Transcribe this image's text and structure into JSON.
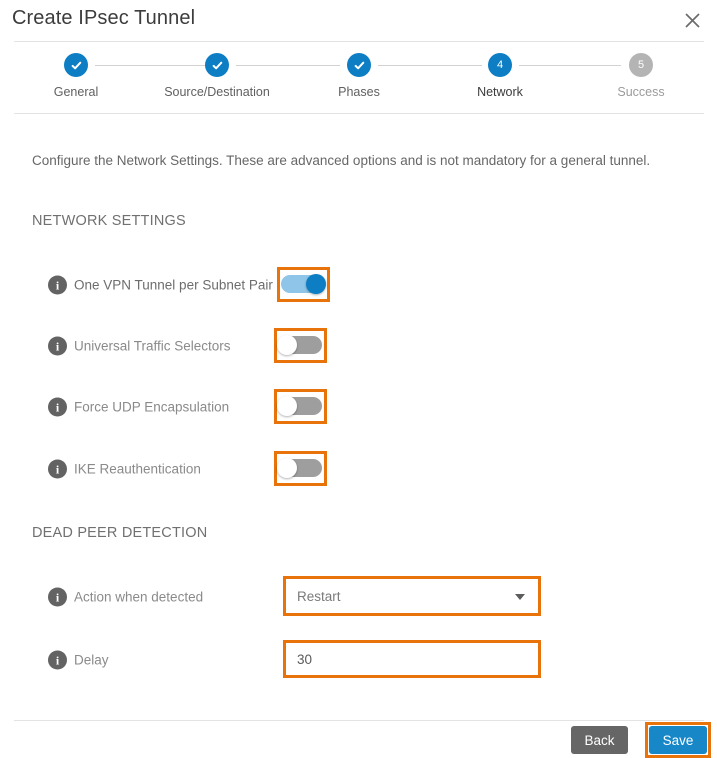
{
  "window": {
    "title": "Create IPsec Tunnel",
    "close_icon": "close-icon"
  },
  "colors": {
    "accent_blue": "#0d7dc4",
    "highlight_orange": "#e8730a",
    "toggle_on_track": "#8ec5e8",
    "toggle_off_track": "#9e9e9e",
    "inactive_gray": "#b4b4b4",
    "save_button": "#1787c8",
    "back_button": "#666666"
  },
  "stepper": {
    "steps": [
      {
        "label": "General",
        "indicator": "check",
        "state": "done"
      },
      {
        "label": "Source/Destination",
        "indicator": "check",
        "state": "done"
      },
      {
        "label": "Phases",
        "indicator": "check",
        "state": "done"
      },
      {
        "label": "Network",
        "indicator": "4",
        "state": "active"
      },
      {
        "label": "Success",
        "indicator": "5",
        "state": "todo"
      }
    ]
  },
  "body": {
    "intro": "Configure the Network Settings. These are advanced options and is not mandatory for a general tunnel.",
    "sections": [
      {
        "title": "NETWORK SETTINGS"
      },
      {
        "title": "DEAD PEER DETECTION"
      }
    ],
    "network_settings": [
      {
        "label": "One VPN Tunnel per Subnet Pair",
        "info_icon": "info-icon",
        "toggle": "on",
        "highlighted": true
      },
      {
        "label": "Universal Traffic Selectors",
        "info_icon": "info-icon",
        "toggle": "off",
        "highlighted": true
      },
      {
        "label": "Force UDP Encapsulation",
        "info_icon": "info-icon",
        "toggle": "off",
        "highlighted": true
      },
      {
        "label": "IKE Reauthentication",
        "info_icon": "info-icon",
        "toggle": "off",
        "highlighted": true
      }
    ],
    "dead_peer_detection": {
      "action": {
        "label": "Action when detected",
        "info_icon": "info-icon",
        "value": "Restart",
        "caret_icon": "chevron-down-icon",
        "highlighted": true
      },
      "delay": {
        "label": "Delay",
        "info_icon": "info-icon",
        "value": "30",
        "placeholder": "",
        "highlighted": true
      }
    }
  },
  "footer": {
    "back_label": "Back",
    "save_label": "Save",
    "save_highlighted": true
  }
}
